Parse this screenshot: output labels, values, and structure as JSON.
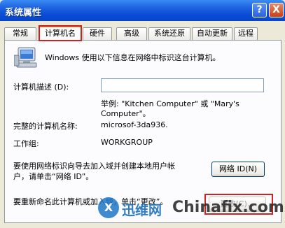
{
  "window": {
    "title": "系统属性",
    "help_glyph": "?",
    "close_glyph": "X"
  },
  "tabs": [
    {
      "label": "常规"
    },
    {
      "label": "计算机名"
    },
    {
      "label": "硬件"
    },
    {
      "label": "高级"
    },
    {
      "label": "系统还原"
    },
    {
      "label": "自动更新"
    },
    {
      "label": "远程"
    }
  ],
  "active_tab": "计算机名",
  "intro_text": "Windows 使用以下信息在网络中标识这台计算机。",
  "description": {
    "label": "计算机描述 (D):",
    "value": "",
    "example_line1": "举例: \"Kitchen Computer\" 或 \"Mary's",
    "example_line2": "Computer\"。"
  },
  "full_name": {
    "label": "完整的计算机名称:",
    "value": "microsof-3da936."
  },
  "workgroup": {
    "label": "工作组:",
    "value": "WORKGROUP"
  },
  "network_id": {
    "text_line1": "要使用网络标识向导去加入域并创建本地用户帐",
    "text_line2": "户，请单击“网络 ID”。",
    "button_label": "网络 ID(N)"
  },
  "rename": {
    "text": "要重新命名此计算机或加入域，单击“更改”。",
    "button_label": "更改(C)..."
  },
  "watermark": {
    "logo_glyph": "X",
    "brand_cn": "迅维网",
    "brand_en": "Chinafix.com"
  },
  "colors": {
    "titlebar": "#0a4cd6",
    "highlight": "#d02020",
    "dialog_bg": "#ece9d8"
  }
}
